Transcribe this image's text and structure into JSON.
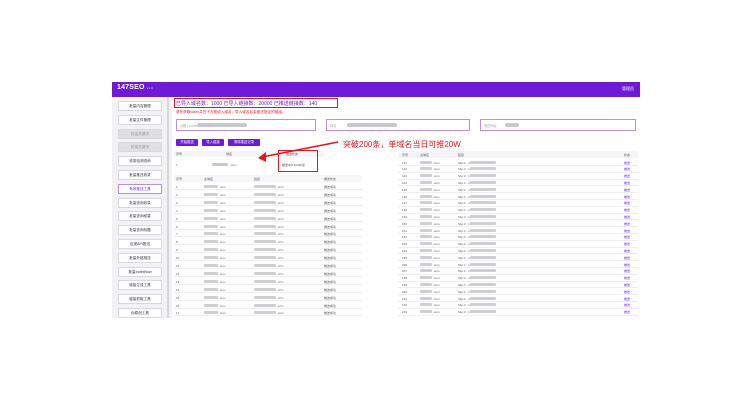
{
  "app": {
    "logo": "147SEO",
    "logo_sub": "v1.0",
    "user": "管理员"
  },
  "colors": {
    "brand": "#6f1bd6",
    "highlight": "#e8141b"
  },
  "sidebar": {
    "items": [
      {
        "label": "批量内容管理",
        "state": "normal"
      },
      {
        "label": "批量文件管理",
        "state": "normal"
      },
      {
        "label": "批量关键词",
        "state": "dim"
      },
      {
        "label": "批量关键词",
        "state": "dim"
      },
      {
        "label": "收录检测查询",
        "state": "normal"
      },
      {
        "label": "批量推送收录",
        "state": "normal"
      },
      {
        "label": "有效推送工具",
        "state": "active"
      },
      {
        "label": "批量查询收录",
        "state": "normal"
      },
      {
        "label": "批量查询权重",
        "state": "normal"
      },
      {
        "label": "批量查询标题",
        "state": "normal"
      },
      {
        "label": "百度API推送",
        "state": "normal"
      },
      {
        "label": "批量外链推送",
        "state": "normal"
      },
      {
        "label": "批量IndexNow",
        "state": "normal"
      },
      {
        "label": "链接生成工具",
        "state": "normal"
      },
      {
        "label": "链接抓取工具",
        "state": "normal"
      },
      {
        "label": "伪原创工具",
        "state": "normal"
      }
    ]
  },
  "stats": {
    "text": "已导入域名数：1000  已导入链接数：20000  已推送链接数：140"
  },
  "hint": "请先获取token并在下方框填入域名，导入域名后会推送指定的链接。",
  "form": {
    "field1_placeholder": "请输入token",
    "field2_placeholder": "域名",
    "field3_placeholder": "推送网址"
  },
  "buttons": {
    "start": "开始推送",
    "import": "导入链接",
    "clear": "清除推送记录"
  },
  "left_table": {
    "head": {
      "no": "序号",
      "domain": "域名",
      "status": "推送状态"
    },
    "top_row": {
      "no": "1",
      "domain_suffix": ".com",
      "status": "推送中(19/200)条"
    },
    "subhead": {
      "no": "序号",
      "domain": "主域名",
      "link": "链接",
      "status": "推送状态"
    },
    "rows": [
      {
        "no": "1",
        "suffix": ".com",
        "link": ".com",
        "status": "推送成功"
      },
      {
        "no": "2",
        "suffix": ".com",
        "link": ".com",
        "status": "推送成功"
      },
      {
        "no": "3",
        "suffix": ".com",
        "link": ".com",
        "status": "推送成功"
      },
      {
        "no": "4",
        "suffix": ".com",
        "link": ".com",
        "status": "推送成功"
      },
      {
        "no": "5",
        "suffix": ".com",
        "link": ".com",
        "status": "推送成功"
      },
      {
        "no": "6",
        "suffix": ".com",
        "link": ".com",
        "status": "推送成功"
      },
      {
        "no": "7",
        "suffix": ".com",
        "link": ".com",
        "status": "推送成功"
      },
      {
        "no": "8",
        "suffix": ".com",
        "link": ".com",
        "status": "推送成功"
      },
      {
        "no": "9",
        "suffix": ".com",
        "link": ".com",
        "status": "推送成功"
      },
      {
        "no": "10",
        "suffix": ".com",
        "link": ".com",
        "status": "推送成功"
      },
      {
        "no": "11",
        "suffix": ".com",
        "link": ".com",
        "status": "推送成功"
      },
      {
        "no": "12",
        "suffix": ".com",
        "link": ".com",
        "status": "推送成功"
      },
      {
        "no": "13",
        "suffix": ".com",
        "link": ".com",
        "status": "推送成功"
      },
      {
        "no": "14",
        "suffix": ".com",
        "link": ".com",
        "status": "推送成功"
      },
      {
        "no": "15",
        "suffix": ".com",
        "link": ".com",
        "status": "推送成功"
      },
      {
        "no": "16",
        "suffix": ".com",
        "link": ".com",
        "status": "推送成功"
      },
      {
        "no": "17",
        "suffix": ".com",
        "link": ".com",
        "status": "推送成功"
      }
    ]
  },
  "right_table": {
    "head": {
      "no": "序号",
      "domain": "主域名",
      "link": "链接",
      "action": "状态"
    },
    "rows": [
      {
        "no": "141",
        "suffix": ".com",
        "link": "http://.../.html",
        "action": "推送"
      },
      {
        "no": "142",
        "suffix": ".com",
        "link": "http://.../.html",
        "action": "推送"
      },
      {
        "no": "143",
        "suffix": ".com",
        "link": "http://.../.html",
        "action": "推送"
      },
      {
        "no": "144",
        "suffix": ".com",
        "link": "http://.../.html",
        "action": "推送"
      },
      {
        "no": "145",
        "suffix": ".com",
        "link": "http://.../.html",
        "action": "推送"
      },
      {
        "no": "146",
        "suffix": ".com",
        "link": "http://.../.html",
        "action": "推送"
      },
      {
        "no": "147",
        "suffix": ".com",
        "link": "http://.../.html",
        "action": "推送"
      },
      {
        "no": "148",
        "suffix": ".com",
        "link": "http://.../.html",
        "action": "推送"
      },
      {
        "no": "149",
        "suffix": ".com",
        "link": "http://.../.html",
        "action": "推送"
      },
      {
        "no": "150",
        "suffix": ".com",
        "link": "http://.../.html",
        "action": "推送"
      },
      {
        "no": "151",
        "suffix": ".com",
        "link": "http://.../.html",
        "action": "推送"
      },
      {
        "no": "152",
        "suffix": ".com",
        "link": "http://.../.html",
        "action": "推送"
      },
      {
        "no": "153",
        "suffix": ".com",
        "link": "http://.../.html",
        "action": "推送"
      },
      {
        "no": "154",
        "suffix": ".com",
        "link": "http://.../.html",
        "action": "推送"
      },
      {
        "no": "155",
        "suffix": ".com",
        "link": "http://.../.html",
        "action": "推送"
      },
      {
        "no": "156",
        "suffix": ".com",
        "link": "http://.../.html",
        "action": "推送"
      },
      {
        "no": "157",
        "suffix": ".com",
        "link": "http://.../.html",
        "action": "推送"
      },
      {
        "no": "158",
        "suffix": ".com",
        "link": "http://.../.html",
        "action": "推送"
      },
      {
        "no": "159",
        "suffix": ".com",
        "link": "http://.../.html",
        "action": "推送"
      },
      {
        "no": "160",
        "suffix": ".com",
        "link": "http://.../.html",
        "action": "推送"
      },
      {
        "no": "161",
        "suffix": ".com",
        "link": "http://.../.html",
        "action": "推送"
      },
      {
        "no": "162",
        "suffix": ".com",
        "link": "http://.../.html",
        "action": "推送"
      },
      {
        "no": "163",
        "suffix": ".com",
        "link": "http://.../.html",
        "action": "推送"
      }
    ]
  },
  "annotation": "突破200条，单域名当日可推20W"
}
